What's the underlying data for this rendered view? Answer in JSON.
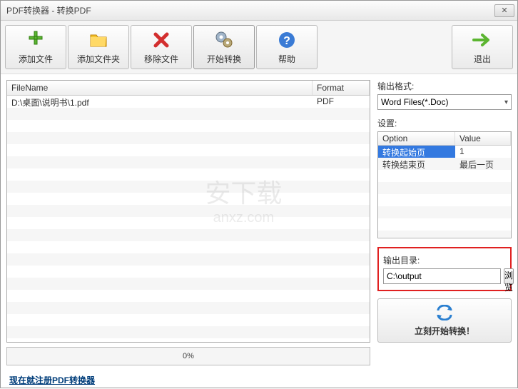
{
  "titlebar": {
    "title": "PDF转换器 - 转换PDF"
  },
  "toolbar": {
    "add_file": "添加文件",
    "add_folder": "添加文件夹",
    "remove_file": "移除文件",
    "start_convert": "开始转换",
    "help": "帮助",
    "exit": "退出"
  },
  "file_table": {
    "header_name": "FileName",
    "header_format": "Format",
    "rows": [
      {
        "name": "D:\\桌面\\说明书\\1.pdf",
        "format": "PDF"
      }
    ]
  },
  "progress": {
    "text": "0%"
  },
  "output_format": {
    "label": "输出格式:",
    "selected": "Word Files(*.Doc)"
  },
  "settings": {
    "label": "设置:",
    "header_option": "Option",
    "header_value": "Value",
    "rows": [
      {
        "option": "转换起始页",
        "value": "1",
        "selected": true
      },
      {
        "option": "转换结束页",
        "value": "最后一页",
        "selected": false
      }
    ]
  },
  "output_dir": {
    "label": "输出目录:",
    "value": "C:\\output",
    "browse": "浏览"
  },
  "convert_now": {
    "label": "立刻开始转换！"
  },
  "footer": {
    "register_link": "现在就注册PDF转换器"
  },
  "watermark": {
    "main": "安下载",
    "sub": "anxz.com"
  }
}
